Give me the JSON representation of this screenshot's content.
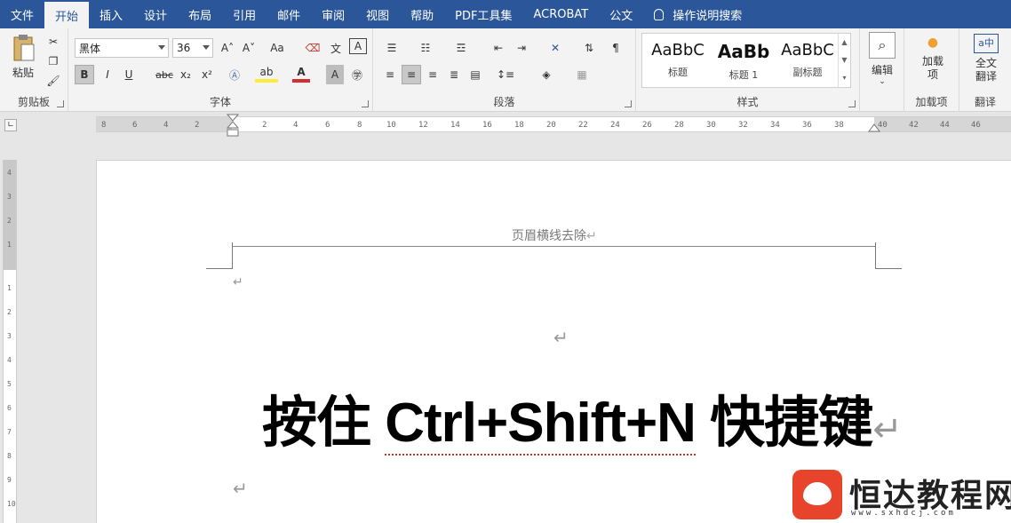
{
  "tabs": [
    "文件",
    "开始",
    "插入",
    "设计",
    "布局",
    "引用",
    "邮件",
    "审阅",
    "视图",
    "帮助",
    "PDF工具集",
    "ACROBAT",
    "公文"
  ],
  "tell_me": "操作说明搜索",
  "clipboard": {
    "paste": "粘贴",
    "label": "剪贴板"
  },
  "font": {
    "name": "黑体",
    "size": "36",
    "label": "字体",
    "grow": "A˄",
    "shrink": "A˅",
    "case": "Aa",
    "bold": "B",
    "italic": "I",
    "underline": "U",
    "strike": "abc",
    "sub": "x₂",
    "sup": "x²",
    "color_a": "A"
  },
  "paragraph": {
    "label": "段落"
  },
  "styles": {
    "label": "样式",
    "items": [
      {
        "sample": "AaBbC",
        "name": "标题"
      },
      {
        "sample": "AaBb",
        "name": "标题 1"
      },
      {
        "sample": "AaBbC",
        "name": "副标题"
      }
    ]
  },
  "editing": {
    "label": "编辑"
  },
  "addins": {
    "btn": "加载项",
    "label": "加载项"
  },
  "translate": {
    "btn": "全文翻译",
    "label": "翻译"
  },
  "ruler": {
    "ticks": [
      "8",
      "6",
      "4",
      "2",
      "2",
      "4",
      "6",
      "8",
      "10",
      "12",
      "14",
      "16",
      "18",
      "20",
      "22",
      "24",
      "26",
      "28",
      "30",
      "32",
      "34",
      "36",
      "38",
      "40",
      "42",
      "44",
      "46"
    ],
    "vticks": [
      "4",
      "3",
      "2",
      "1",
      "1",
      "2",
      "3",
      "4",
      "5",
      "6",
      "7",
      "8",
      "9",
      "10"
    ]
  },
  "document": {
    "header_text": "页眉横线去除",
    "headline_pre": "按住 ",
    "headline_shortcut": "Ctrl+Shift+N",
    "headline_post": " 快捷键",
    "pilcrow": "↵"
  },
  "watermark": {
    "brand": "恒达教程网",
    "url": "www.sxhdcj.com"
  },
  "colors": {
    "accent": "#2b579a",
    "ribbon": "#f3f3f3",
    "logo": "#e8442b"
  }
}
